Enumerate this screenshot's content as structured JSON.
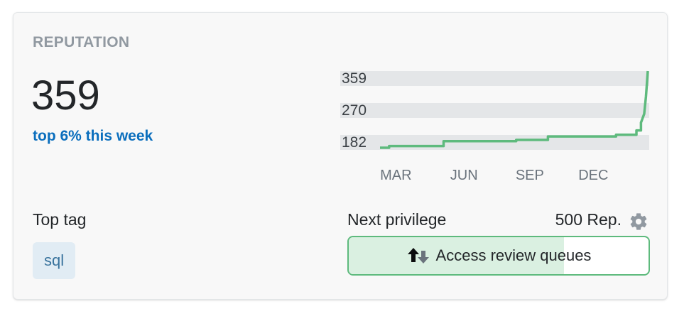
{
  "reputation": {
    "heading": "REPUTATION",
    "score": "359",
    "rank_text": "top 6% this week"
  },
  "chart_data": {
    "type": "line",
    "y_ticks": [
      "359",
      "270",
      "182"
    ],
    "x_ticks": [
      "MAR",
      "JUN",
      "SEP",
      "DEC"
    ],
    "ylim": [
      182,
      359
    ],
    "color": "#5eba7d",
    "points": [
      [
        0,
        182
      ],
      [
        2,
        182
      ],
      [
        2,
        186
      ],
      [
        14,
        186
      ],
      [
        14,
        197
      ],
      [
        30,
        197
      ],
      [
        30,
        200
      ],
      [
        37,
        200
      ],
      [
        37,
        208
      ],
      [
        52,
        208
      ],
      [
        52,
        212
      ],
      [
        56.5,
        212
      ],
      [
        56.5,
        222
      ],
      [
        57.5,
        222
      ],
      [
        57.5,
        240
      ],
      [
        58.2,
        260
      ],
      [
        58.6,
        300
      ],
      [
        59,
        359
      ]
    ],
    "x_tick_positions": [
      3.5,
      18.5,
      33,
      47
    ],
    "x_range": [
      0,
      59
    ]
  },
  "top_tag": {
    "label": "Top tag",
    "tag": "sql"
  },
  "next_privilege": {
    "label": "Next privilege",
    "rep_needed": "500 Rep.",
    "name": "Access review queues",
    "progress": 0.718,
    "icon": "up-down-arrows-icon",
    "settings_icon": "gear-icon"
  }
}
